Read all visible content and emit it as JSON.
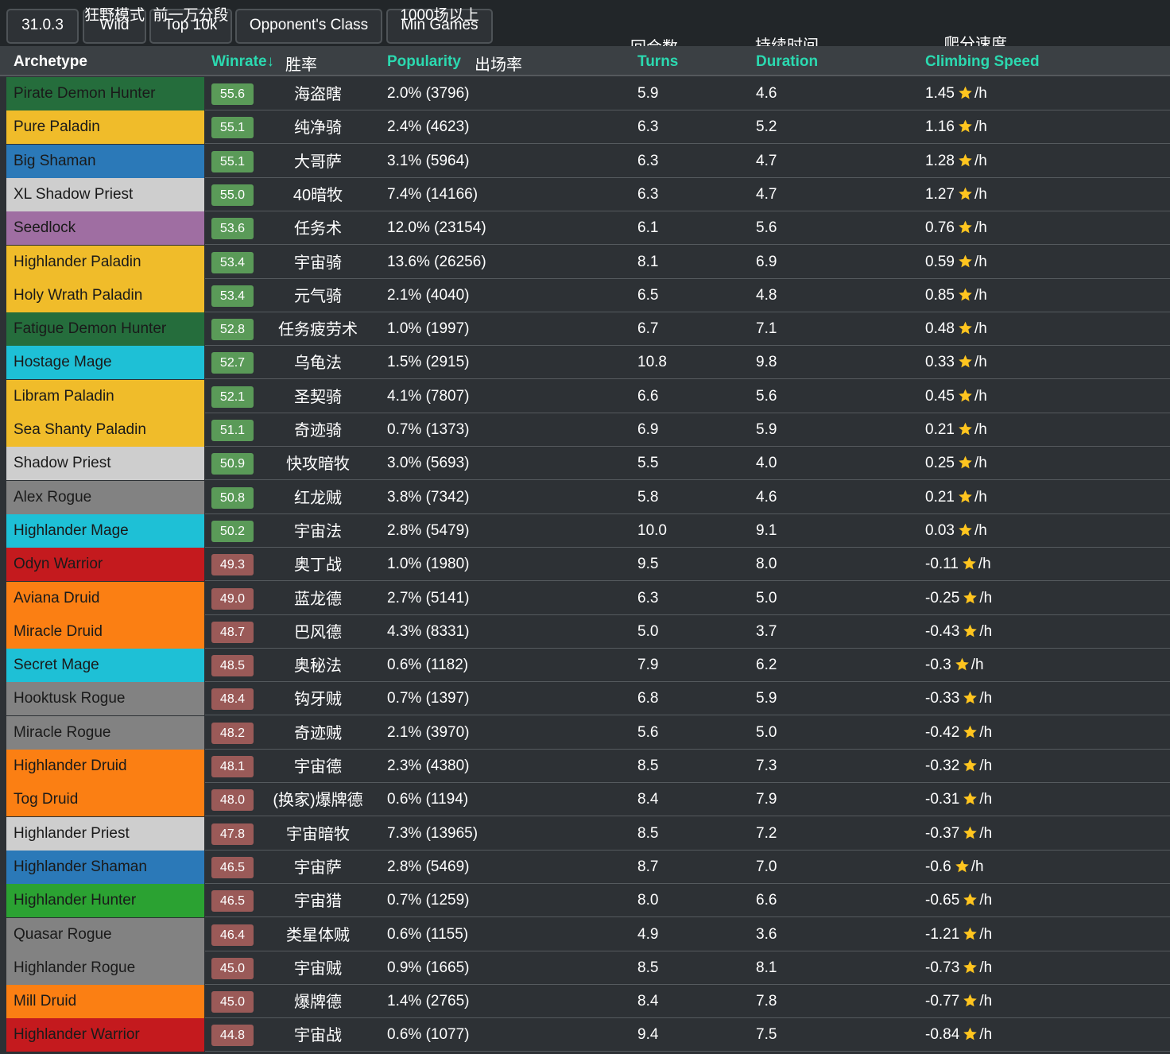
{
  "filters": {
    "patch": {
      "label": "31.0.3"
    },
    "mode": {
      "label": "Wild",
      "cn": "狂野模式"
    },
    "rank": {
      "label": "Top 10k",
      "cn": "前一万分段"
    },
    "opponent": {
      "label": "Opponent's Class"
    },
    "min_games": {
      "label": "Min Games",
      "cn": "1000场以上"
    }
  },
  "headers": {
    "archetype": "Archetype",
    "winrate": "Winrate↓",
    "winrate_cn": "胜率",
    "popularity": "Popularity",
    "popularity_cn": "出场率",
    "turns": "Turns",
    "turns_cn": "回合数",
    "duration": "Duration",
    "duration_cn": "持续时间",
    "climbing": "Climbing Speed",
    "climbing_cn": "爬分速度",
    "per_hour": "/h"
  },
  "colors": {
    "demonhunter": "#256d3c",
    "paladin": "#f0bc2a",
    "shaman": "#2b79b8",
    "priest": "#cecece",
    "warlock": "#9f6ea2",
    "mage": "#1ec0d6",
    "rogue": "#828282",
    "warrior": "#c41a1e",
    "druid": "#fb7f13",
    "hunter": "#2ba232",
    "wr_high": "#5a9a58",
    "wr_low": "#9a5a58",
    "star": "#ffc51f"
  },
  "rows": [
    {
      "archetype": "Pirate Demon Hunter",
      "cls": "demonhunter",
      "winrate": "55.6",
      "cn": "海盗瞎",
      "popularity": "2.0% (3796)",
      "turns": "5.9",
      "duration": "4.6",
      "climbing": "1.45"
    },
    {
      "archetype": "Pure Paladin",
      "cls": "paladin",
      "winrate": "55.1",
      "cn": "纯净骑",
      "popularity": "2.4% (4623)",
      "turns": "6.3",
      "duration": "5.2",
      "climbing": "1.16"
    },
    {
      "archetype": "Big Shaman",
      "cls": "shaman",
      "winrate": "55.1",
      "cn": "大哥萨",
      "popularity": "3.1% (5964)",
      "turns": "6.3",
      "duration": "4.7",
      "climbing": "1.28"
    },
    {
      "archetype": "XL Shadow Priest",
      "cls": "priest",
      "winrate": "55.0",
      "cn": "40暗牧",
      "popularity": "7.4% (14166)",
      "turns": "6.3",
      "duration": "4.7",
      "climbing": "1.27"
    },
    {
      "archetype": "Seedlock",
      "cls": "warlock",
      "winrate": "53.6",
      "cn": "任务术",
      "popularity": "12.0% (23154)",
      "turns": "6.1",
      "duration": "5.6",
      "climbing": "0.76"
    },
    {
      "archetype": "Highlander Paladin",
      "cls": "paladin",
      "winrate": "53.4",
      "cn": "宇宙骑",
      "popularity": "13.6% (26256)",
      "turns": "8.1",
      "duration": "6.9",
      "climbing": "0.59"
    },
    {
      "archetype": "Holy Wrath Paladin",
      "cls": "paladin",
      "winrate": "53.4",
      "cn": "元气骑",
      "popularity": "2.1% (4040)",
      "turns": "6.5",
      "duration": "4.8",
      "climbing": "0.85"
    },
    {
      "archetype": "Fatigue Demon Hunter",
      "cls": "demonhunter",
      "winrate": "52.8",
      "cn": "任务疲劳术",
      "popularity": "1.0% (1997)",
      "turns": "6.7",
      "duration": "7.1",
      "climbing": "0.48"
    },
    {
      "archetype": "Hostage Mage",
      "cls": "mage",
      "winrate": "52.7",
      "cn": "乌龟法",
      "popularity": "1.5% (2915)",
      "turns": "10.8",
      "duration": "9.8",
      "climbing": "0.33"
    },
    {
      "archetype": "Libram Paladin",
      "cls": "paladin",
      "winrate": "52.1",
      "cn": "圣契骑",
      "popularity": "4.1% (7807)",
      "turns": "6.6",
      "duration": "5.6",
      "climbing": "0.45"
    },
    {
      "archetype": "Sea Shanty Paladin",
      "cls": "paladin",
      "winrate": "51.1",
      "cn": "奇迹骑",
      "popularity": "0.7% (1373)",
      "turns": "6.9",
      "duration": "5.9",
      "climbing": "0.21"
    },
    {
      "archetype": "Shadow Priest",
      "cls": "priest",
      "winrate": "50.9",
      "cn": "快攻暗牧",
      "popularity": "3.0% (5693)",
      "turns": "5.5",
      "duration": "4.0",
      "climbing": "0.25"
    },
    {
      "archetype": "Alex Rogue",
      "cls": "rogue",
      "winrate": "50.8",
      "cn": "红龙贼",
      "popularity": "3.8% (7342)",
      "turns": "5.8",
      "duration": "4.6",
      "climbing": "0.21"
    },
    {
      "archetype": "Highlander Mage",
      "cls": "mage",
      "winrate": "50.2",
      "cn": "宇宙法",
      "popularity": "2.8% (5479)",
      "turns": "10.0",
      "duration": "9.1",
      "climbing": "0.03"
    },
    {
      "archetype": "Odyn Warrior",
      "cls": "warrior",
      "winrate": "49.3",
      "cn": "奥丁战",
      "popularity": "1.0% (1980)",
      "turns": "9.5",
      "duration": "8.0",
      "climbing": "-0.11"
    },
    {
      "archetype": "Aviana Druid",
      "cls": "druid",
      "winrate": "49.0",
      "cn": "蓝龙德",
      "popularity": "2.7% (5141)",
      "turns": "6.3",
      "duration": "5.0",
      "climbing": "-0.25"
    },
    {
      "archetype": "Miracle Druid",
      "cls": "druid",
      "winrate": "48.7",
      "cn": "巴风德",
      "popularity": "4.3% (8331)",
      "turns": "5.0",
      "duration": "3.7",
      "climbing": "-0.43"
    },
    {
      "archetype": "Secret Mage",
      "cls": "mage",
      "winrate": "48.5",
      "cn": "奥秘法",
      "popularity": "0.6% (1182)",
      "turns": "7.9",
      "duration": "6.2",
      "climbing": "-0.3"
    },
    {
      "archetype": "Hooktusk Rogue",
      "cls": "rogue",
      "winrate": "48.4",
      "cn": "钩牙贼",
      "popularity": "0.7% (1397)",
      "turns": "6.8",
      "duration": "5.9",
      "climbing": "-0.33"
    },
    {
      "archetype": "Miracle Rogue",
      "cls": "rogue",
      "winrate": "48.2",
      "cn": "奇迹贼",
      "popularity": "2.1% (3970)",
      "turns": "5.6",
      "duration": "5.0",
      "climbing": "-0.42"
    },
    {
      "archetype": "Highlander Druid",
      "cls": "druid",
      "winrate": "48.1",
      "cn": "宇宙德",
      "popularity": "2.3% (4380)",
      "turns": "8.5",
      "duration": "7.3",
      "climbing": "-0.32"
    },
    {
      "archetype": "Tog Druid",
      "cls": "druid",
      "winrate": "48.0",
      "cn": "(换家)爆牌德",
      "popularity": "0.6% (1194)",
      "turns": "8.4",
      "duration": "7.9",
      "climbing": "-0.31"
    },
    {
      "archetype": "Highlander Priest",
      "cls": "priest",
      "winrate": "47.8",
      "cn": "宇宙暗牧",
      "popularity": "7.3% (13965)",
      "turns": "8.5",
      "duration": "7.2",
      "climbing": "-0.37"
    },
    {
      "archetype": "Highlander Shaman",
      "cls": "shaman",
      "winrate": "46.5",
      "cn": "宇宙萨",
      "popularity": "2.8% (5469)",
      "turns": "8.7",
      "duration": "7.0",
      "climbing": "-0.6"
    },
    {
      "archetype": "Highlander Hunter",
      "cls": "hunter",
      "winrate": "46.5",
      "cn": "宇宙猎",
      "popularity": "0.7% (1259)",
      "turns": "8.0",
      "duration": "6.6",
      "climbing": "-0.65"
    },
    {
      "archetype": "Quasar Rogue",
      "cls": "rogue",
      "winrate": "46.4",
      "cn": "类星体贼",
      "popularity": "0.6% (1155)",
      "turns": "4.9",
      "duration": "3.6",
      "climbing": "-1.21"
    },
    {
      "archetype": "Highlander Rogue",
      "cls": "rogue",
      "winrate": "45.0",
      "cn": "宇宙贼",
      "popularity": "0.9% (1665)",
      "turns": "8.5",
      "duration": "8.1",
      "climbing": "-0.73"
    },
    {
      "archetype": "Mill Druid",
      "cls": "druid",
      "winrate": "45.0",
      "cn": "爆牌德",
      "popularity": "1.4% (2765)",
      "turns": "8.4",
      "duration": "7.8",
      "climbing": "-0.77"
    },
    {
      "archetype": "Highlander Warrior",
      "cls": "warrior",
      "winrate": "44.8",
      "cn": "宇宙战",
      "popularity": "0.6% (1077)",
      "turns": "9.4",
      "duration": "7.5",
      "climbing": "-0.84"
    }
  ]
}
